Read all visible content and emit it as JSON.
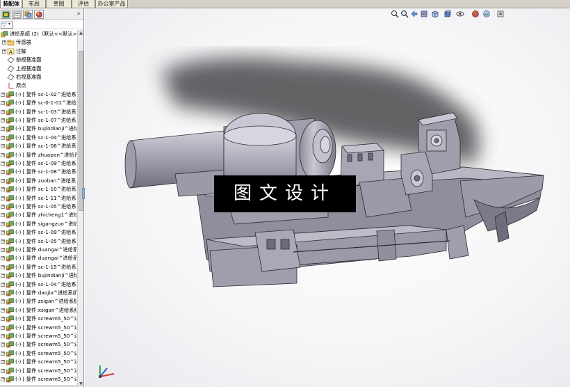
{
  "tabs": [
    {
      "label": "装配体",
      "active": true
    },
    {
      "label": "布局",
      "active": false
    },
    {
      "label": "草图",
      "active": false
    },
    {
      "label": "评估",
      "active": false
    },
    {
      "label": "办公室产品",
      "active": false
    }
  ],
  "panel": {
    "collapse_glyph": "»",
    "filter_glyph": "▽",
    "toolbar_icons": [
      "feature-manager-icon",
      "property-manager-icon",
      "configuration-manager-icon",
      "display-manager-icon"
    ]
  },
  "tree": {
    "root": "进给系统 (2)（默认<<默认>_",
    "fixed_items": [
      {
        "label": "传感器",
        "icon": "sensor-folder-icon"
      },
      {
        "label": "注解",
        "icon": "annotation-icon"
      },
      {
        "label": "前视基准面",
        "icon": "plane-icon"
      },
      {
        "label": "上视基准面",
        "icon": "plane-icon"
      },
      {
        "label": "右视基准面",
        "icon": "plane-icon"
      },
      {
        "label": "原点",
        "icon": "origin-icon"
      }
    ],
    "components": [
      "(-) [ 复件 sc-1-02^进给系",
      "(-) [ 复件 sc-0-1-01^进给",
      "(-) [ 复件 sc-1-03^进给系",
      "(-) [ 复件 sc-1-07^进给系",
      "(-) [ 复件 bujindianji^进给",
      "(-) [ 复件 sc-1-04^进给系",
      "(-) [ 复件 sc-1-06^进给系",
      "(-) [ 复件 zhuapan^进给系",
      "(-) [ 复件 sc-1-09^进给系",
      "(-) [ 复件 sc-1-08^进给系",
      "(-) [ 复件 zuoban^进给系",
      "(-) [ 复件 sc-1-10^进给系",
      "(-) [ 复件 sc-1-11^进给系",
      "(-) [ 复件 sc-1-05^进给系",
      "(-) [ 复件 zhicheng1^进给",
      "(-) [ 复件 sigangzuo^进给",
      "(-) [ 复件 sc-1-09^进给系",
      "(-) [ 复件 sc-1-05^进给系",
      "(-) [ 复件 duangai^进给系",
      "(-) [ 复件 duangai^进给系",
      "(-) [ 复件 sc-1-15^进给系",
      "(-) [ 复件 bujindianji^进给",
      "(-) [ 复件 sc-1-04^进给系",
      "(-) [ 复件 daojia^进给系统",
      "(-) [ 复件 zsigan^进给系统",
      "(-) [ 复件 xsigan^进给系统",
      "(-) [ 复件 screwm5_50^进",
      "(-) [ 复件 screwm5_50^进",
      "(-) [ 复件 screwm5_50^进",
      "(-) [ 复件 screwm5_50^进",
      "(-) [ 复件 screwm5_50^进",
      "(-) [ 复件 screwm5_50^进",
      "(-) [ 复件 screwm5_50^进",
      "(-) [ 复件 screwm5_50^进"
    ]
  },
  "view_toolbar": [
    "zoom-fit-icon",
    "zoom-area-icon",
    "previous-view-icon",
    "section-view-icon",
    "view-orientation-icon",
    "display-style-icon",
    "hide-show-icon",
    "appearance-icon",
    "scene-icon",
    "view-settings-icon"
  ],
  "watermark": {
    "text": "图文设计"
  },
  "colors": {
    "model_face": "#9e9eac",
    "model_light": "#c4c4d0",
    "model_dark": "#6c6c7a",
    "edge": "#2a2a32",
    "shadow": "#4a4a4e",
    "tab_bar": "#d4d0c8"
  }
}
